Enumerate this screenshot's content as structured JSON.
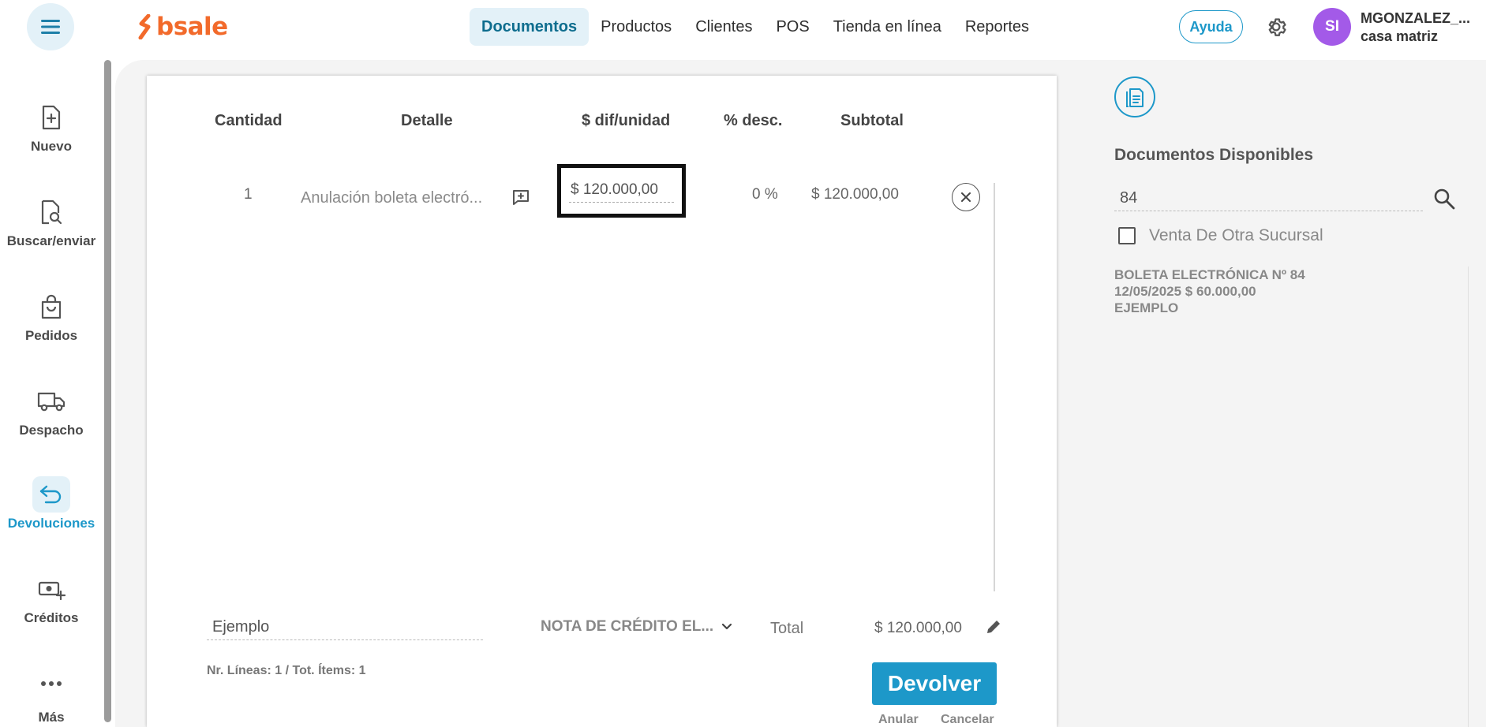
{
  "header": {
    "logo_text": "bsale",
    "nav": [
      {
        "label": "Documentos",
        "active": true
      },
      {
        "label": "Productos",
        "active": false
      },
      {
        "label": "Clientes",
        "active": false
      },
      {
        "label": "POS",
        "active": false
      },
      {
        "label": "Tienda en línea",
        "active": false
      },
      {
        "label": "Reportes",
        "active": false
      }
    ],
    "help_label": "Ayuda",
    "user": {
      "initials": "SI",
      "name": "MGONZALEZ_...",
      "branch": "casa matriz"
    }
  },
  "sidebar": {
    "items": [
      {
        "label": "Nuevo",
        "icon": "file-plus-icon"
      },
      {
        "label": "Buscar/enviar",
        "icon": "file-search-icon"
      },
      {
        "label": "Pedidos",
        "icon": "shopping-bag-icon"
      },
      {
        "label": "Despacho",
        "icon": "truck-icon"
      },
      {
        "label": "Devoluciones",
        "icon": "return-arrow-icon",
        "active": true
      },
      {
        "label": "Créditos",
        "icon": "cash-plus-icon"
      },
      {
        "label": "Más",
        "icon": "more-dots-icon"
      }
    ]
  },
  "table": {
    "headers": {
      "quantity": "Cantidad",
      "detail": "Detalle",
      "unit_diff": "$ dif/unidad",
      "discount": "% desc.",
      "subtotal": "Subtotal"
    },
    "rows": [
      {
        "quantity": "1",
        "detail": "Anulación boleta electró...",
        "unit_diff": "$ 120.000,00",
        "discount": "0 %",
        "subtotal": "$ 120.000,00"
      }
    ]
  },
  "footer": {
    "comment_value": "Ejemplo",
    "document_type": "NOTA DE CRÉDITO EL...",
    "total_label": "Total",
    "total_value": "$ 120.000,00",
    "lines_info": "Nr. Líneas: 1 / Tot. Ítems: 1",
    "primary_button": "Devolver",
    "void_link": "Anular",
    "cancel_link": "Cancelar"
  },
  "right_panel": {
    "title": "Documentos Disponibles",
    "search_value": "84",
    "checkbox_label": "Venta De Otra Sucursal",
    "checkbox_checked": false,
    "results": [
      {
        "line1": "BOLETA ELECTRÓNICA Nº 84",
        "line2": "12/05/2025 $ 60.000,00",
        "line3": "EJEMPLO"
      }
    ]
  },
  "colors": {
    "accent": "#1d98c9",
    "brand": "#f26a2b",
    "avatar": "#a35ae8"
  }
}
